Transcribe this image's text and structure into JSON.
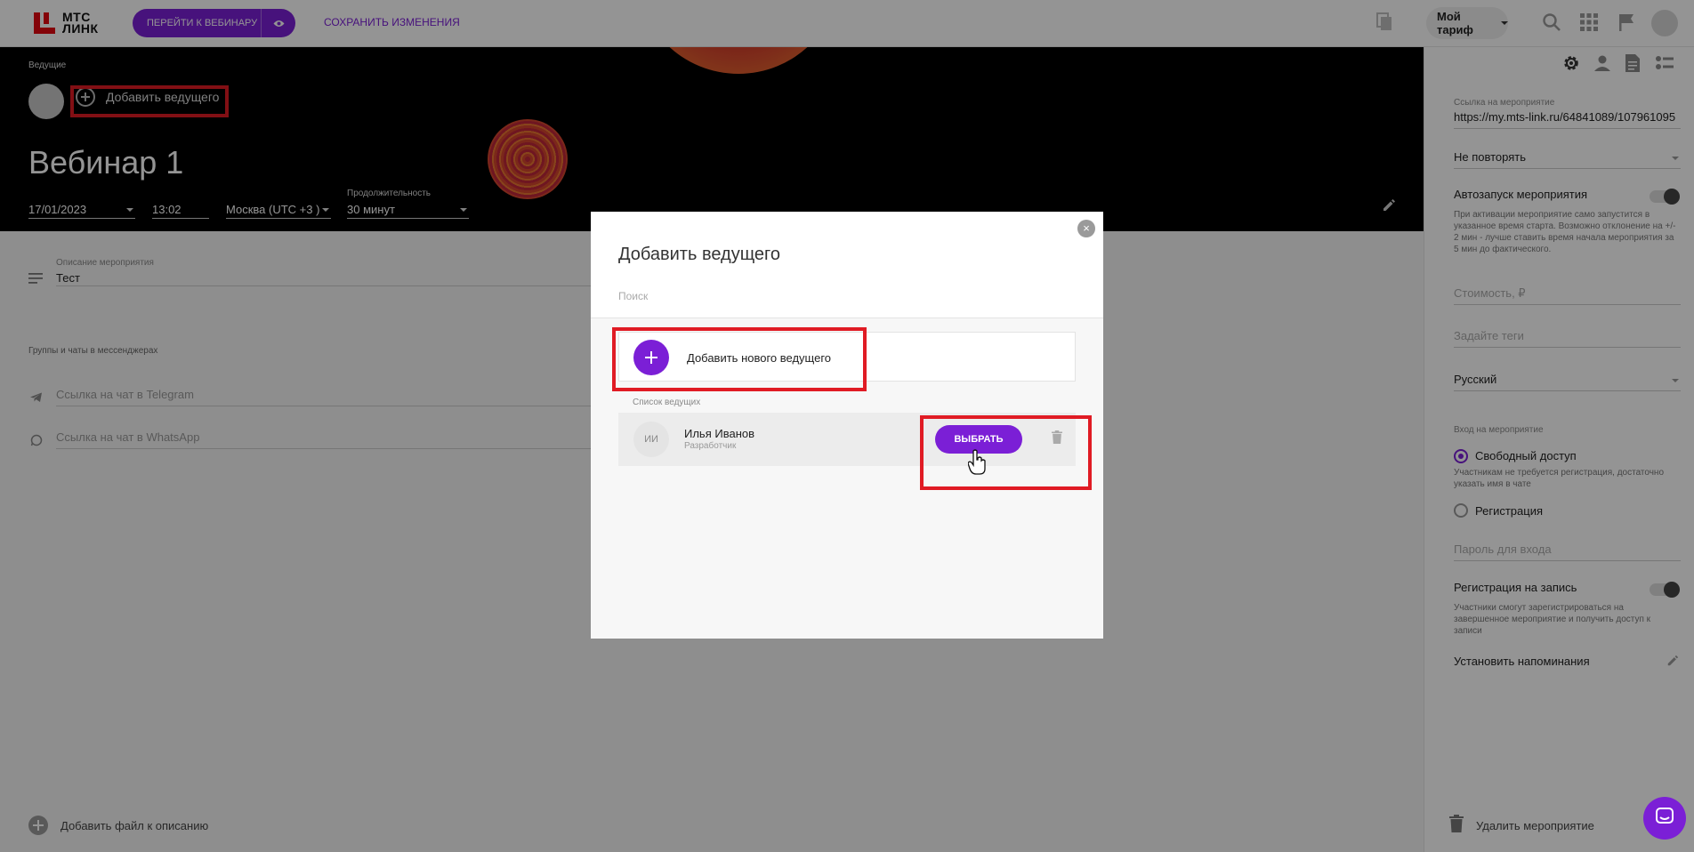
{
  "header": {
    "logo_line1": "МТС",
    "logo_line2": "ЛИНК",
    "go_to_webinar": "ПЕРЕЙТИ К ВЕБИНАРУ",
    "save_changes": "СОХРАНИТЬ ИЗМЕНЕНИЯ",
    "tariff": "Мой тариф",
    "icons": [
      "copy-icon",
      "search-icon",
      "apps-grid-icon",
      "flag-icon",
      "user-avatar"
    ]
  },
  "hero": {
    "hosts_label": "Ведущие",
    "add_host": "Добавить ведущего",
    "title": "Вебинар 1",
    "date": "17/01/2023",
    "time": "13:02",
    "timezone": "Москва (UTC +3 )",
    "duration_label": "Продолжительность",
    "duration": "30 минут"
  },
  "content": {
    "description_label": "Описание мероприятия",
    "description_value": "Тест",
    "groups_label": "Группы и чаты в мессенджерах",
    "telegram_placeholder": "Ссылка на чат в Telegram",
    "whatsapp_placeholder": "Ссылка на чат в WhatsApp",
    "add_file": "Добавить файл к описанию"
  },
  "right_panel": {
    "tabs": [
      "settings-icon",
      "person-icon",
      "document-icon",
      "list-icon"
    ],
    "link_label": "Ссылка на мероприятие",
    "link_value": "https://my.mts-link.ru/64841089/107961095",
    "repeat": "Не повторять",
    "autostart_label": "Автозапуск мероприятия",
    "autostart_note": "При активации мероприятие само запустится в указанное время старта. Возможно отклонение на +/- 2 мин - лучше ставить время начала мероприятия за 5 мин до фактического.",
    "price_placeholder": "Стоимость, ₽",
    "tags_placeholder": "Задайте теги",
    "language": "Русский",
    "entry_label": "Вход на мероприятие",
    "free_access": "Свободный доступ",
    "free_access_note": "Участникам не требуется регистрация, достаточно указать имя в чате",
    "registration": "Регистрация",
    "password_placeholder": "Пароль для входа",
    "record_registration_label": "Регистрация на запись",
    "record_registration_note": "Участники смогут зарегистрироваться на завершенное мероприятие и получить доступ к записи",
    "reminders": "Установить напоминания",
    "delete_event": "Удалить мероприятие"
  },
  "modal": {
    "title": "Добавить ведущего",
    "search_placeholder": "Поиск",
    "add_new_host": "Добавить нового ведущего",
    "list_label": "Список ведущих",
    "hosts": [
      {
        "initials": "ИИ",
        "name": "Илья Иванов",
        "role": "Разработчик",
        "select_label": "ВЫБРАТЬ"
      }
    ]
  },
  "colors": {
    "accent": "#7b1fd6",
    "brand_red": "#e30611",
    "highlight": "#e01b24"
  }
}
